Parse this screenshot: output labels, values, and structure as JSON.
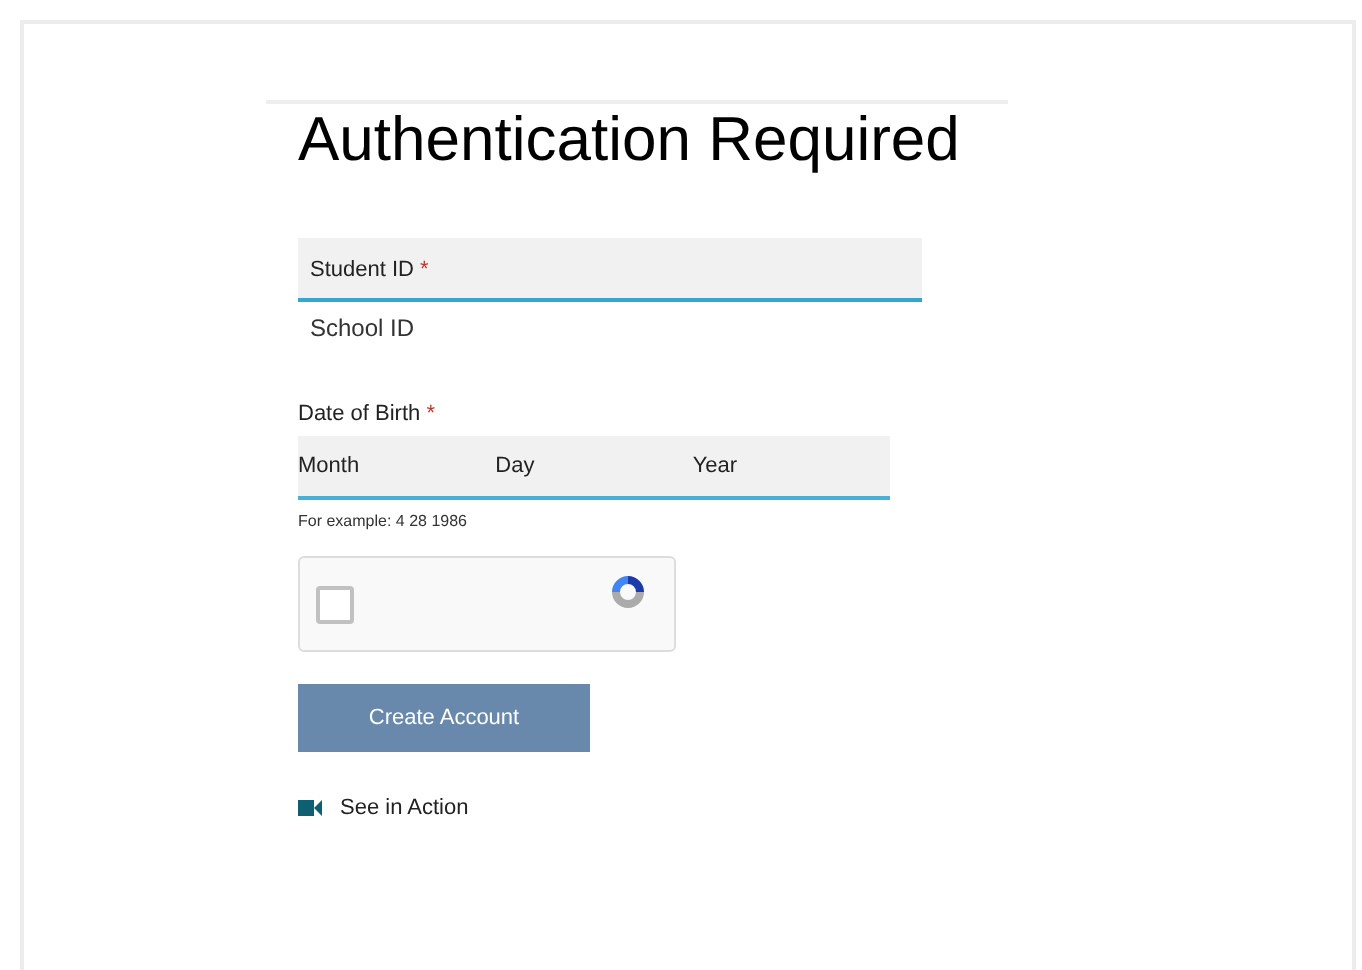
{
  "title": "Authentication Required",
  "student_id": {
    "label": "Student ID",
    "required_mark": "*",
    "hint": "School ID"
  },
  "date_of_birth": {
    "label": "Date of Birth",
    "required_mark": "*",
    "fields": [
      {
        "placeholder": "Month"
      },
      {
        "placeholder": "Day"
      },
      {
        "placeholder": "Year"
      }
    ],
    "hint": "For example: 4 28 1986"
  },
  "captcha": {
    "checked": false
  },
  "submit_button": "Create Account",
  "video_link": "See in Action"
}
